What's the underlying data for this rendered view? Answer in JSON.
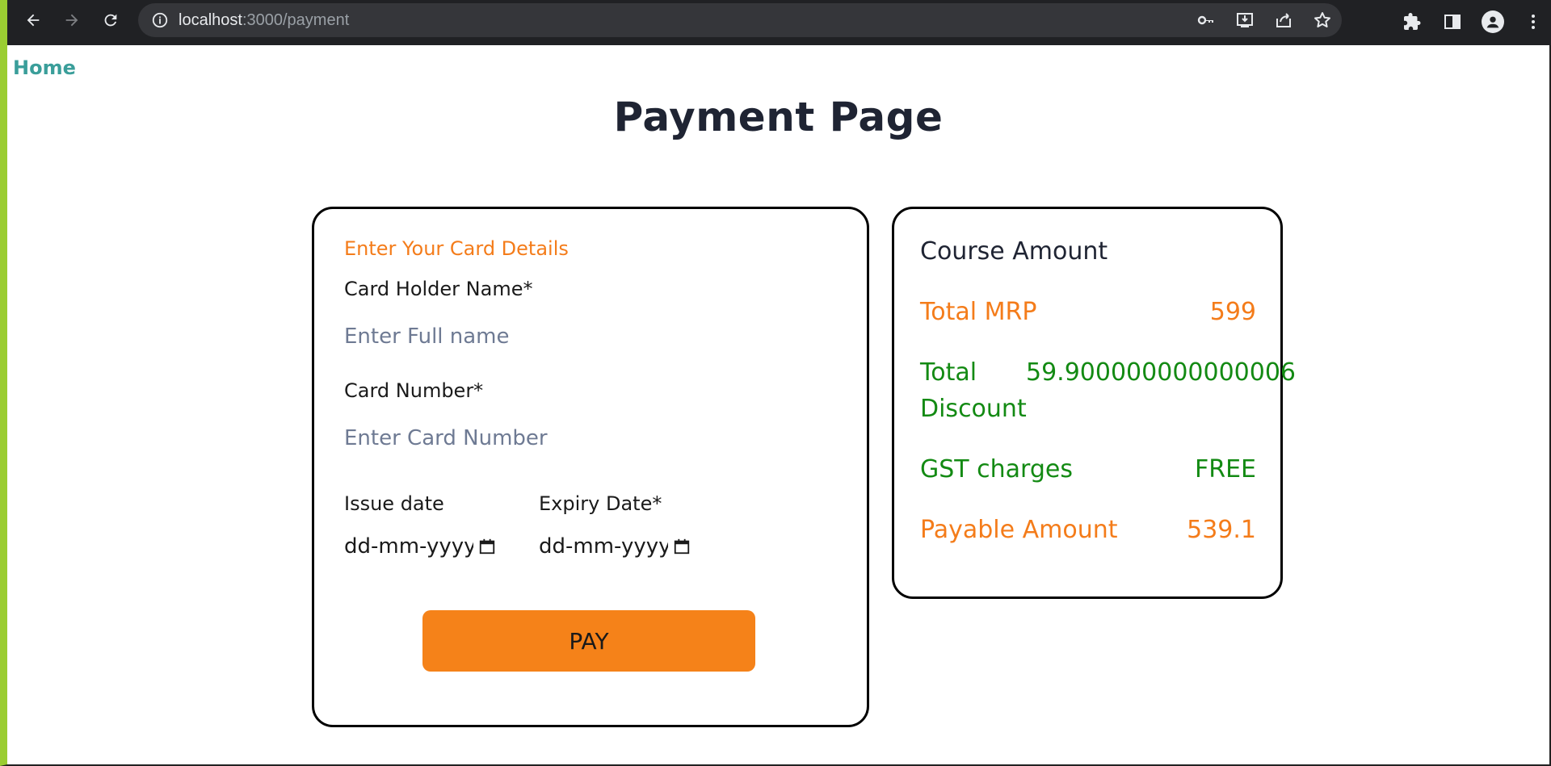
{
  "browser": {
    "url_host": "localhost",
    "url_path": ":3000/payment"
  },
  "page": {
    "home_link": "Home",
    "title": "Payment Page"
  },
  "card_form": {
    "heading": "Enter Your Card Details",
    "holder_label": "Card Holder Name*",
    "holder_placeholder": "Enter Full name",
    "number_label": "Card Number*",
    "number_placeholder": "Enter Card Number",
    "issue_label": "Issue date",
    "issue_value": "dd-mm-yyyy",
    "expiry_label": "Expiry Date*",
    "expiry_value": "dd-mm-yyyy",
    "pay_label": "PAY"
  },
  "summary": {
    "title": "Course Amount",
    "mrp_label": "Total MRP",
    "mrp_value": "599",
    "discount_label_1": "Total",
    "discount_label_2": "Discount",
    "discount_value": "59.900000000000006",
    "gst_label": "GST charges",
    "gst_value": "FREE",
    "payable_label": "Payable Amount",
    "payable_value": "539.1"
  },
  "colors": {
    "accent_orange": "#f58219",
    "discount_green": "#138a13",
    "home_teal": "#3a9e9a",
    "frame_green": "#9acd32"
  }
}
